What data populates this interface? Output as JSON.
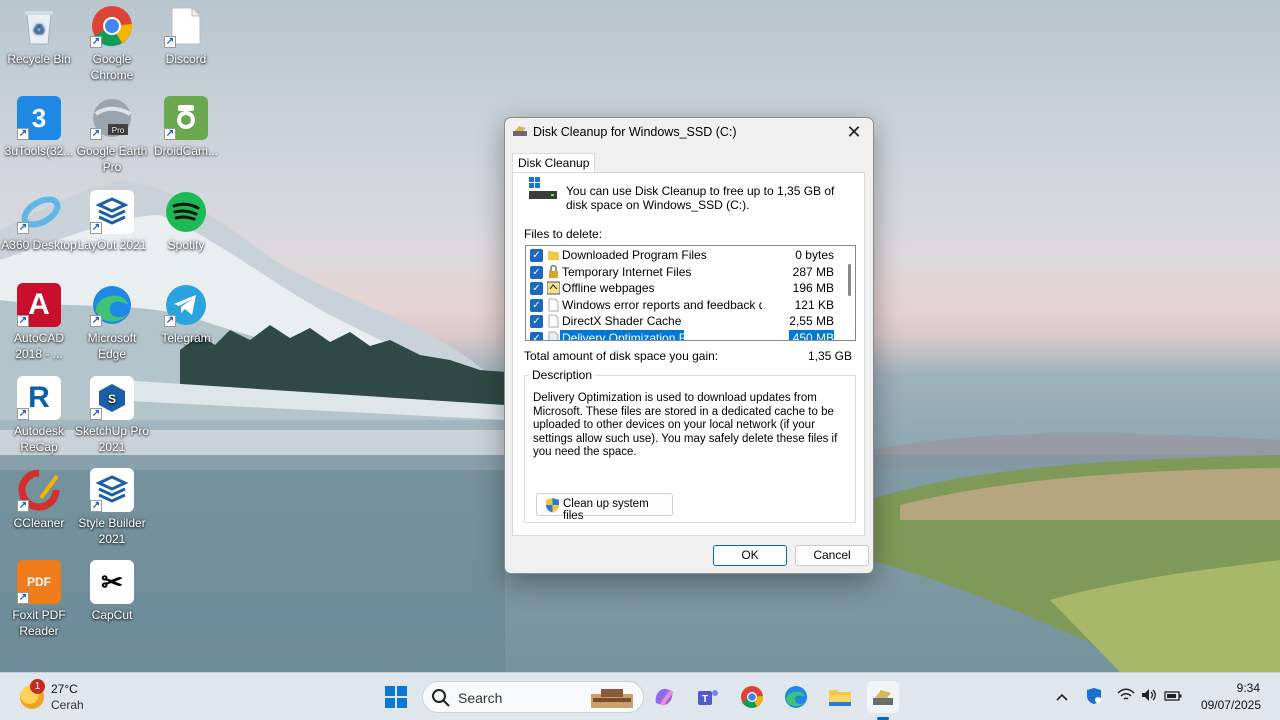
{
  "desktop": {
    "icons": [
      {
        "label": "Recycle Bin",
        "icon": "recycle-bin-icon"
      },
      {
        "label": "Google Chrome",
        "icon": "chrome-icon"
      },
      {
        "label": "Discord",
        "icon": "discord-file-icon"
      },
      {
        "label": "3uTools(32...",
        "icon": "3utools-icon"
      },
      {
        "label": "Google Earth Pro",
        "icon": "google-earth-icon"
      },
      {
        "label": "DroidCam...",
        "icon": "droidcam-icon"
      },
      {
        "label": "A360 Desktop",
        "icon": "a360-icon"
      },
      {
        "label": "LayOut 2021",
        "icon": "layout-icon"
      },
      {
        "label": "Spotify",
        "icon": "spotify-icon"
      },
      {
        "label": "AutoCAD 2018 - ...",
        "icon": "autocad-icon"
      },
      {
        "label": "Microsoft Edge",
        "icon": "edge-icon"
      },
      {
        "label": "Telegram",
        "icon": "telegram-icon"
      },
      {
        "label": "Autodesk ReCap",
        "icon": "recap-icon"
      },
      {
        "label": "SketchUp Pro 2021",
        "icon": "sketchup-icon"
      },
      {
        "label": "CCleaner",
        "icon": "ccleaner-icon"
      },
      {
        "label": "Style Builder 2021",
        "icon": "style-builder-icon"
      },
      {
        "label": "Foxit PDF Reader",
        "icon": "foxit-icon"
      },
      {
        "label": "CapCut",
        "icon": "capcut-icon"
      }
    ]
  },
  "dialog": {
    "title": "Disk Cleanup for Windows_SSD (C:)",
    "tab": "Disk Cleanup",
    "intro": "You can use Disk Cleanup to free up to 1,35 GB of disk space on Windows_SSD (C:).",
    "files_label": "Files to delete:",
    "files": [
      {
        "name": "Downloaded Program Files",
        "size": "0 bytes",
        "checked": true
      },
      {
        "name": "Temporary Internet Files",
        "size": "287 MB",
        "checked": true
      },
      {
        "name": "Offline webpages",
        "size": "196 MB",
        "checked": true
      },
      {
        "name": "Windows error reports and feedback dia...",
        "size": "121 KB",
        "checked": true
      },
      {
        "name": "DirectX Shader Cache",
        "size": "2,55 MB",
        "checked": true
      },
      {
        "name": "Delivery Optimization Files",
        "size": "450 MB",
        "checked": true
      }
    ],
    "total_label": "Total amount of disk space you gain:",
    "total_value": "1,35 GB",
    "description_label": "Description",
    "description": "Delivery Optimization is used to download updates from Microsoft. These files are stored in a dedicated cache to be uploaded to other devices on your local network (if your settings allow such use). You may safely delete these files if you need the space.",
    "cleanup_button": "Clean up system files",
    "ok_button": "OK",
    "cancel_button": "Cancel",
    "close_glyph": "✕"
  },
  "taskbar": {
    "weather_temp": "27°C",
    "weather_condition": "Cerah",
    "weather_badge": "1",
    "search_placeholder": "Search",
    "time": "9:34",
    "date": "09/07/2025"
  },
  "colors": {
    "accent": "#0067c0",
    "selection": "#0078d7",
    "checkbox": "#1b68c0"
  }
}
